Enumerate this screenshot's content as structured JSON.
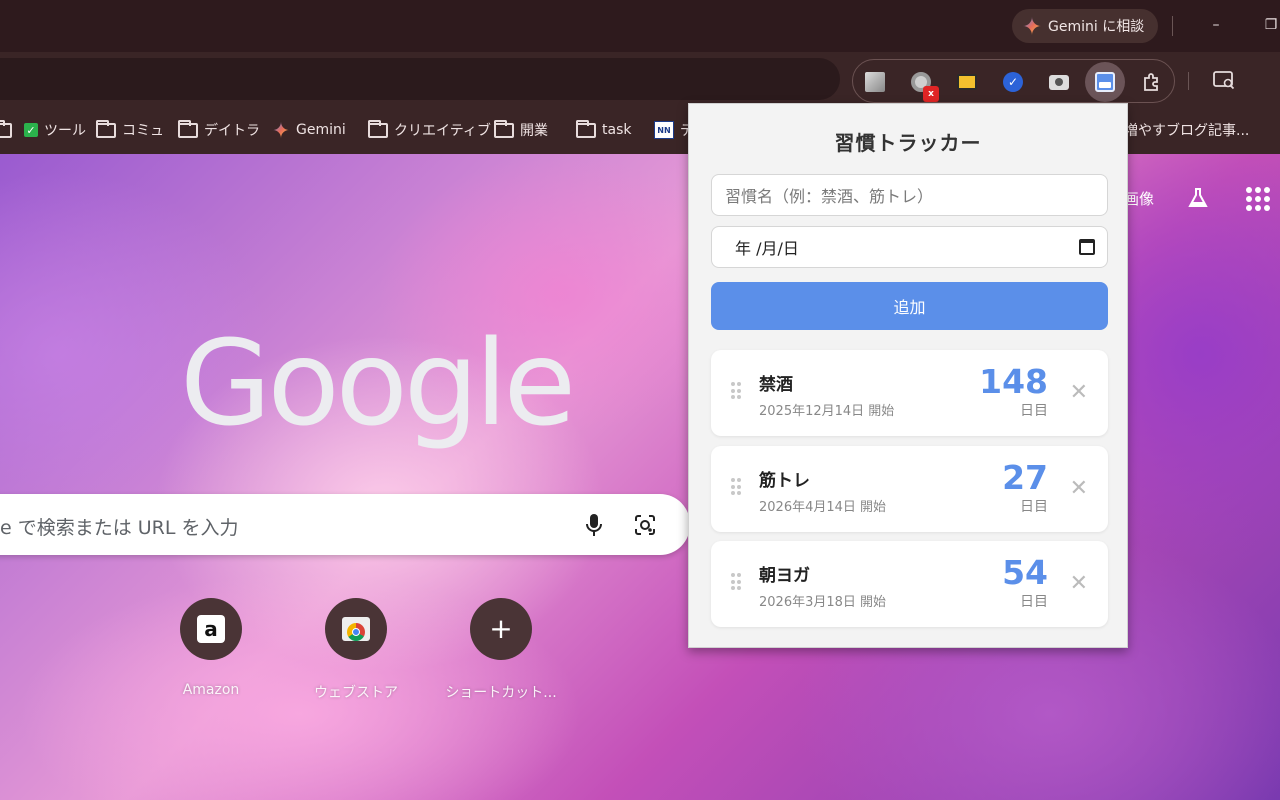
{
  "titlebar": {
    "gemini_label": "Gemini に相談",
    "minimize_glyph": "–",
    "restore_glyph": "❐"
  },
  "extensions": [
    {
      "name": "gray-square-ext-icon"
    },
    {
      "name": "record-ext-icon",
      "badge": "x"
    },
    {
      "name": "folder-ext-icon"
    },
    {
      "name": "check-circle-ext-icon"
    },
    {
      "name": "camera-ext-icon"
    },
    {
      "name": "calendar-ext-icon",
      "active": true
    },
    {
      "name": "puzzle-icon"
    }
  ],
  "bookmarks": [
    {
      "label": "ツール",
      "type": "check"
    },
    {
      "label": "コミュ",
      "type": "folder"
    },
    {
      "label": "デイトラ",
      "type": "folder"
    },
    {
      "label": "Gemini",
      "type": "gemini"
    },
    {
      "label": "クリエイティブ",
      "type": "folder"
    },
    {
      "label": "開業",
      "type": "folder"
    },
    {
      "label": "task",
      "type": "folder"
    },
    {
      "label": "デ",
      "type": "site"
    },
    {
      "label": "増やすブログ記事...",
      "type": "text"
    }
  ],
  "page": {
    "logo": "Google",
    "images_link": "画像",
    "search_placeholder": "e で検索または URL を入力",
    "shortcuts": [
      {
        "label": "Amazon"
      },
      {
        "label": "ウェブストア"
      },
      {
        "label": "ショートカット..."
      }
    ]
  },
  "popup": {
    "title": "習慣トラッカー",
    "name_placeholder": "習慣名（例：禁酒、筋トレ）",
    "date_placeholder": "年 /月/日",
    "add_label": "追加",
    "habits": [
      {
        "name": "禁酒",
        "start": "2025年12月14日 開始",
        "days": "148",
        "unit": "日目"
      },
      {
        "name": "筋トレ",
        "start": "2026年4月14日 開始",
        "days": "27",
        "unit": "日目"
      },
      {
        "name": "朝ヨガ",
        "start": "2026年3月18日 開始",
        "days": "54",
        "unit": "日目"
      }
    ],
    "delete_glyph": "✕"
  },
  "colors": {
    "accent": "#5b8fe9",
    "titlebar": "#2e1a1d",
    "toolbar": "#3a2526"
  }
}
